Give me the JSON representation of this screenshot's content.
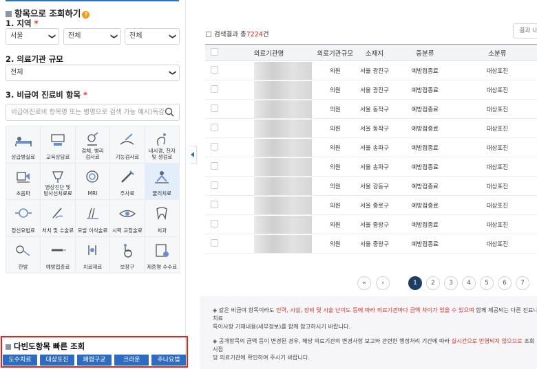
{
  "left": {
    "section_title": "항목으로 조회하기",
    "region": {
      "label": "1. 지역",
      "required": "*",
      "selects": [
        "서울",
        "전체",
        "전체"
      ]
    },
    "org_size": {
      "label": "2. 의료기관 규모",
      "value": "전체"
    },
    "noncovered": {
      "label": "3. 비급여 진료비 항목",
      "required": "*",
      "placeholder": "비급여진료비 항목명 또는 병명으로 검색 가능 예시)독감"
    },
    "categories": [
      {
        "label": "상급병실료",
        "icon": "hospital-bed-icon"
      },
      {
        "label": "교육상담료",
        "icon": "counseling-icon"
      },
      {
        "label": "검체, 병리\n검사료",
        "icon": "microscope-icon"
      },
      {
        "label": "기능검사료",
        "icon": "function-test-icon"
      },
      {
        "label": "내시경, 천자\n및 생검료",
        "icon": "endoscope-icon"
      },
      {
        "label": "초음파",
        "icon": "ultrasound-icon"
      },
      {
        "label": "영상진단 및\n방사선치료료",
        "icon": "xray-icon"
      },
      {
        "label": "MRI",
        "icon": "mri-icon"
      },
      {
        "label": "주사료",
        "icon": "syringe-icon"
      },
      {
        "label": "물리치료",
        "icon": "physical-therapy-icon",
        "active": true
      },
      {
        "label": "정신요법료",
        "icon": "brain-icon"
      },
      {
        "label": "처치 및 수술료",
        "icon": "surgery-icon"
      },
      {
        "label": "모발 이식술료",
        "icon": "hair-transplant-icon"
      },
      {
        "label": "시력 교정술료",
        "icon": "eye-icon"
      },
      {
        "label": "치과",
        "icon": "tooth-icon"
      },
      {
        "label": "한방",
        "icon": "acupuncture-icon"
      },
      {
        "label": "예방접종료",
        "icon": "vaccine-icon"
      },
      {
        "label": "치료재료",
        "icon": "medical-material-icon"
      },
      {
        "label": "보장구",
        "icon": "wheelchair-icon"
      },
      {
        "label": "제증명 수수료",
        "icon": "certificate-icon"
      }
    ],
    "frequent": {
      "title": "다빈도항목 빠른 조회",
      "buttons": [
        "도수치료",
        "대상포진",
        "폐렴구균",
        "크라운",
        "추나요법"
      ]
    }
  },
  "right": {
    "result_prefix": "검색결과 총",
    "result_count": "7224",
    "result_suffix": "건",
    "filter_placeholder": "결과 내",
    "columns": [
      "의료기관명",
      "의료기관규모",
      "소재지",
      "중분류",
      "소분류"
    ],
    "rows": [
      {
        "size": "의원",
        "loc": "서울 광진구",
        "mid": "예방접종료",
        "sub": "대상포진"
      },
      {
        "size": "의원",
        "loc": "서울 광진구",
        "mid": "예방접종료",
        "sub": "대상포진"
      },
      {
        "size": "의원",
        "loc": "서울 동작구",
        "mid": "예방접종료",
        "sub": "대상포진"
      },
      {
        "size": "의원",
        "loc": "서울 동작구",
        "mid": "예방접종료",
        "sub": "대상포진"
      },
      {
        "size": "의원",
        "loc": "서울 송파구",
        "mid": "예방접종료",
        "sub": "대상포진"
      },
      {
        "size": "의원",
        "loc": "서울 송파구",
        "mid": "예방접종료",
        "sub": "대상포진"
      },
      {
        "size": "의원",
        "loc": "서울 강동구",
        "mid": "예방접종료",
        "sub": "대상포진"
      },
      {
        "size": "의원",
        "loc": "서울 종로구",
        "mid": "예방접종료",
        "sub": "대상포진"
      },
      {
        "size": "의원",
        "loc": "서울 중랑구",
        "mid": "예방접종료",
        "sub": "대상포진"
      },
      {
        "size": "의원",
        "loc": "서울 중랑구",
        "mid": "예방접종료",
        "sub": "대상포진"
      }
    ],
    "pagination": {
      "first": "«",
      "prev": "‹",
      "pages": [
        "1",
        "2",
        "3",
        "4",
        "5",
        "6",
        "7"
      ],
      "current": "1"
    },
    "notes": [
      {
        "pre": "◈ 같은 비급여 항목이라도 ",
        "hl": "인력, 시설, 장비 및 시술 난이도 등에 따라 의료기관마다 금액 차이가 있을 수 있으며",
        "post": " 함께 제공되는 다른 진료나 치료",
        "line2": "특이사항 기재내용(세부정보)를 함께 참고하시기 바랍니다."
      },
      {
        "pre": "◈ 공개항목의 금액 등이 변경된 경우, 해당 의료기관의 변경사항 보고와 관련한 행정처리 기간에 따라 ",
        "hl": "실시간으로 반영되지 않으므로",
        "post": " 조회 시점",
        "line2": "당 의료기관에 확인하여 주시기 바랍니다."
      }
    ]
  }
}
